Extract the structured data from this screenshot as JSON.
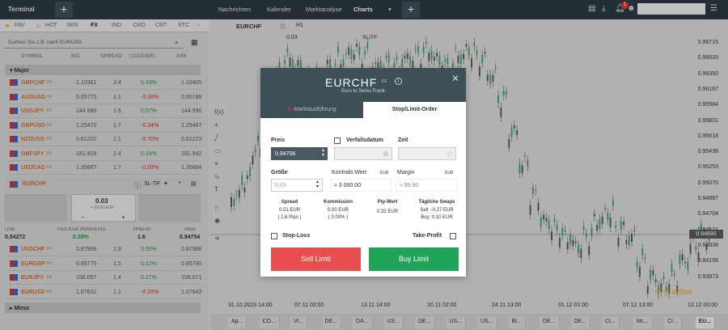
{
  "topbar": {
    "title": "Terminal",
    "nav": [
      "Nachrichten",
      "Kalender",
      "Marktanalyse",
      "Charts"
    ],
    "badge": "1"
  },
  "categories": [
    "FAV",
    "HOT",
    "SEN",
    "FX",
    "IND",
    "CMD",
    "CRT",
    "STC"
  ],
  "search_placeholder": "Suchen Sie.z.B. nach EURUSD",
  "columns": [
    "SYMBOL",
    "BID",
    "SPREAD",
    "(1D)ÄNDE..",
    "ASK"
  ],
  "group_major": "Major",
  "group_minor": "Minor",
  "rows": [
    {
      "sym": "GBPCHF",
      "bid": "1.10381",
      "spr": "3.4",
      "chg": "0.19%",
      "ask": "1.10405",
      "dir": "pos"
    },
    {
      "sym": "AUDUSD",
      "bid": "0.65775",
      "spr": "1.1",
      "chg": "-0.28%",
      "ask": "0.65786",
      "dir": "neg"
    },
    {
      "sym": "USDJPY",
      "bid": "144.980",
      "spr": "1.6",
      "chg": "0.57%",
      "ask": "144.996",
      "dir": "pos"
    },
    {
      "sym": "GBPUSD",
      "bid": "1.25470",
      "spr": "1.7",
      "chg": "-0.34%",
      "ask": "1.25487",
      "dir": "neg"
    },
    {
      "sym": "NZDUSD",
      "bid": "0.61202",
      "spr": "2.1",
      "chg": "-0.70%",
      "ask": "0.61223",
      "dir": "neg"
    },
    {
      "sym": "GBPJPY",
      "bid": "181.918",
      "spr": "2.4",
      "chg": "0.24%",
      "ask": "181.942",
      "dir": "pos"
    },
    {
      "sym": "USDCAD",
      "bid": "1.35867",
      "spr": "1.7",
      "chg": "-0.09%",
      "ask": "1.35884",
      "dir": "neg"
    }
  ],
  "expanded": {
    "sym": "EURCHF",
    "sltp": "SL-TP",
    "price": "0.03",
    "sub": "+ 99.00 EUR",
    "low_lbl": "LOW",
    "low": "0.94272",
    "chg_lbl": "TÄGLICHE ÄNDERUNG",
    "chg": "0.28%",
    "spr_lbl": "SPREAD",
    "spr": "1.6",
    "high_lbl": "HIGH",
    "high": "0.94754"
  },
  "rows2": [
    {
      "sym": "USDCHF",
      "bid": "0.87969",
      "spr": "1.9",
      "chg": "0.50%",
      "ask": "0.87988",
      "dir": "pos"
    },
    {
      "sym": "EURGBP",
      "bid": "0.85775",
      "spr": "1.5",
      "chg": "0.12%",
      "ask": "0.85790",
      "dir": "pos"
    },
    {
      "sym": "EURJPY",
      "bid": "156.057",
      "spr": "1.4",
      "chg": "0.27%",
      "ask": "156.071",
      "dir": "pos"
    },
    {
      "sym": "EURUSD",
      "bid": "1.07632",
      "spr": "1.1",
      "chg": "-0.28%",
      "ask": "1.07643",
      "dir": "neg"
    }
  ],
  "chart": {
    "symbol": "EURCHF",
    "tf": "H1",
    "qty": "0.03",
    "sltp": "SL/TP",
    "price_tag": "0.94690",
    "countdown": "07m 43Sek",
    "yticks": [
      "0.96715",
      "0.96533",
      "0.96350",
      "0.96167",
      "0.95984",
      "0.95801",
      "0.95618",
      "0.95436",
      "0.95253",
      "0.95070",
      "0.94887",
      "0.94704",
      "0.94521",
      "0.94338",
      "0.94156",
      "0.93973"
    ],
    "xticks": [
      "31.10.2023 14:00",
      "07.11 02:00",
      "13.11 14:00",
      "20.11 02:00",
      "24.11 13:00",
      "01.12 01:00",
      "07.12 13:00",
      "12.12 00:00"
    ]
  },
  "bottom_tabs": [
    "Ap...",
    "CO...",
    "VI...",
    "DE...",
    "DA...",
    "US...",
    "DE...",
    "US...",
    "US...",
    "BI...",
    "DE...",
    "DE...",
    "CI...",
    "Mc...",
    "CI...",
    "EU..."
  ],
  "modal": {
    "title": "EURCHF",
    "fx": "FX",
    "subtitle": "Euro to Swiss Frank",
    "tab_market": "Marktausführung",
    "tab_limit": "Stop/Limit-Order",
    "price_label": "Preis",
    "price_value": "0.94706",
    "expiry_label": "Verfallsdatum",
    "time_label": "Zeit",
    "size_label": "Größe",
    "size_value": "0.03",
    "contract_label": "Kontrakt-Wert",
    "contract_unit": "EUR",
    "contract_value": "≈ 3 000.00",
    "margin_label": "Margin",
    "margin_unit": "EUR",
    "margin_value": "≈ 99.90",
    "spread_h": "Spread",
    "spread_v1": "0.51 EUR",
    "spread_v2": "( 1.6 Pips )",
    "comm_h": "Kommission",
    "comm_v1": "0.00 EUR",
    "comm_v2": "( 0.00% )",
    "pip_h": "Pip-Wert",
    "pip_v": "0.32 EUR",
    "swap_h": "Tägliche Swaps",
    "swap_v1": "Sell: -0.27 EUR",
    "swap_v2": "Buy: 0.10 EUR",
    "stoploss": "Stop-Loss",
    "takeprofit": "Take-Profit",
    "sell": "Sell Limit",
    "buy": "Buy Limit"
  },
  "colors": {
    "sell": "#e94e4e",
    "buy": "#20a45a",
    "header": "#3d4f57"
  }
}
